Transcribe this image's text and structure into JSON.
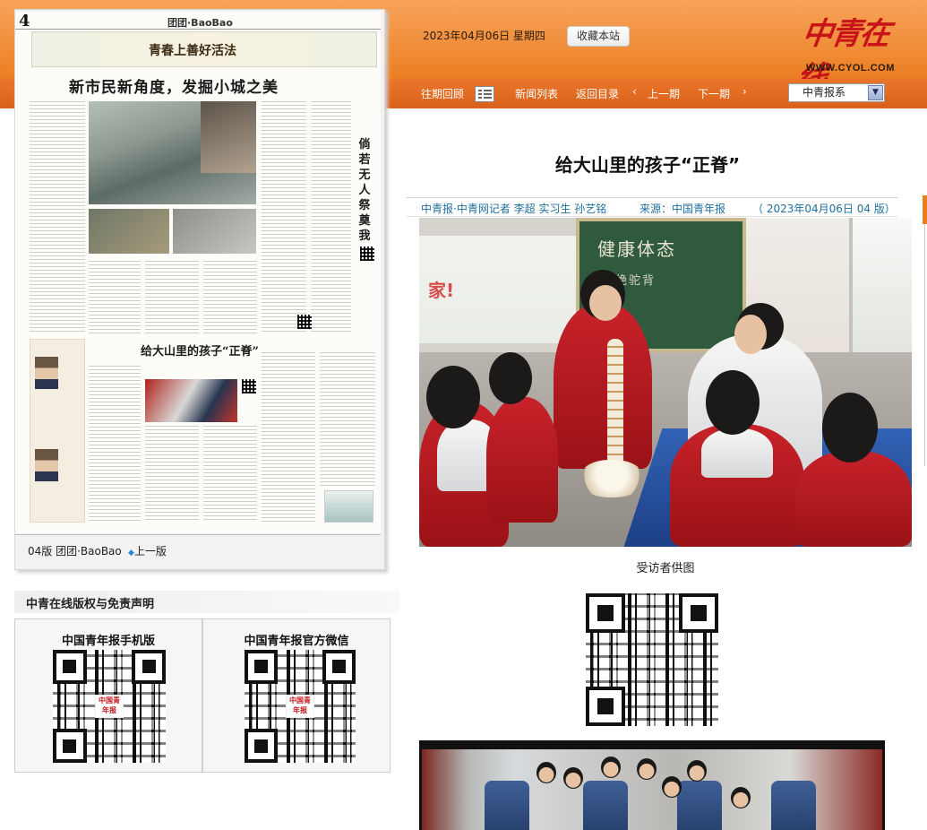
{
  "header": {
    "date_text": "2023年04月06日  星期四",
    "favorite_button": "收藏本站",
    "logo_text": "中青在线",
    "logo_url_text": "WWW.CYOL.COM"
  },
  "nav": {
    "archive": "往期回顾",
    "news_list": "新闻列表",
    "back_to_contents": "返回目录",
    "prev_page": "上一期",
    "next_page": "下一期",
    "prev_arrow": "‹",
    "next_arrow": "›",
    "series_select": "中青报系",
    "select_chevron": "▼"
  },
  "paper_page": {
    "page_number": "4",
    "page_name": "团团·BaoBao",
    "banner": "青春上善好活法",
    "headline_main": "新市民新角度，发掘小城之美",
    "vertical_title": "倘若无人祭奠我",
    "headline_secondary": "给大山里的孩子“正脊”",
    "caption": "04版 团团·BaoBao",
    "prev_link": "上一版",
    "prev_link_icon": "◆"
  },
  "copyright": {
    "title": "中青在线版权与免责声明",
    "qr_mobile_label": "中国青年报手机版",
    "qr_wechat_label": "中国青年报官方微信",
    "qr_logo_text": "中国青年报"
  },
  "article": {
    "title": "给大山里的孩子“正脊”",
    "byline": "中青报·中青网记者 李超 实习生 孙艺铭",
    "source": "来源：中国青年报",
    "meta": "（ 2023年04月06日    04 版）",
    "photo_board_text": "健康体态",
    "photo_board_text2": "拒绝驼背",
    "photo_poster_text": "家!",
    "photo_caption": "受访者供图"
  },
  "colors": {
    "header_orange": "#ef8a33",
    "nav_orange": "#d9611a",
    "link_blue": "#1f6f9f",
    "logo_red": "#c81418"
  }
}
